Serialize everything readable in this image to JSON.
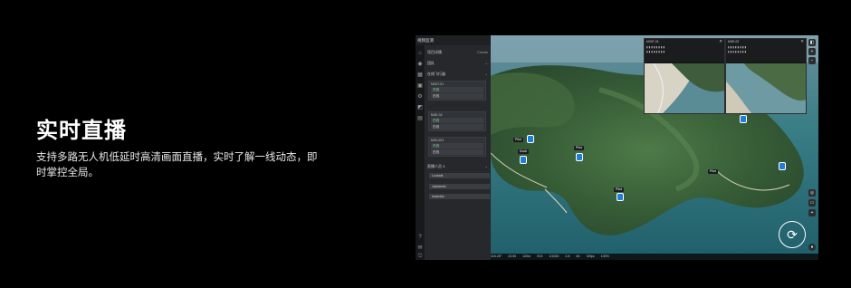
{
  "hero": {
    "title": "实时直播",
    "description": "支持多路无人机低延时高清画面直播，实时了解一线动态，即时掌控全局。"
  },
  "app": {
    "project_title": "视频监测",
    "sections": {
      "project_label": "项目详情",
      "create_label": "Create",
      "team_label": "团队",
      "flight_label": "在线飞行器",
      "livestream_label": "直播人员 3"
    },
    "devices": [
      {
        "name": "M30T-01",
        "sub": "在线"
      },
      {
        "name": "M3E-02",
        "sub": "在线"
      },
      {
        "name": "M30-003",
        "sub": "在线"
      }
    ],
    "live_users": [
      "Lookalk",
      "Jakelewis",
      "Isabeldo"
    ],
    "map_labels": [
      "Pilot",
      "Pilot",
      "Dock",
      "Pilot",
      "Pilot"
    ],
    "video_windows": [
      {
        "title": "M30T-01"
      },
      {
        "title": "M3E-02"
      }
    ],
    "status": [
      "116.25°",
      "23.50",
      "120m",
      "ISO",
      "1/1000",
      "2.8",
      "4K",
      "30fps",
      "100%"
    ],
    "refresh_glyph": "⟳",
    "colors": {
      "accent": "#1f7fd6",
      "online": "#8fd19e",
      "background": "#000000"
    }
  }
}
